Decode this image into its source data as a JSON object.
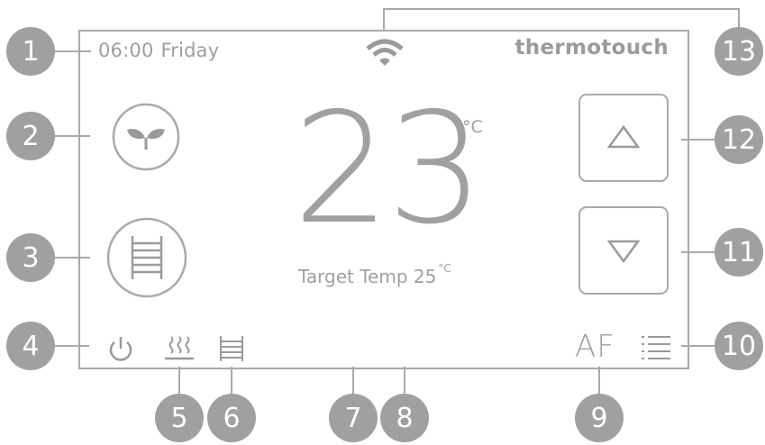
{
  "header": {
    "time": "06:00",
    "day": "Friday",
    "brand": "thermotouch"
  },
  "display": {
    "current_temp": "23",
    "unit": "°C",
    "target_label": "Target Temp 25",
    "target_unit": "°C",
    "mode_label": "AF"
  },
  "icons": {
    "wifi": "wifi-icon",
    "eco": "leaf-icon",
    "towel_rail": "towel-rail-icon",
    "power": "power-icon",
    "floor_heating": "floor-heating-icon",
    "towel_small": "towel-rail-small-icon",
    "menu": "menu-list-icon",
    "up": "up-arrow-icon",
    "down": "down-arrow-icon"
  },
  "callouts": [
    "1",
    "2",
    "3",
    "4",
    "5",
    "6",
    "7",
    "8",
    "9",
    "10",
    "11",
    "12",
    "13"
  ],
  "colors": {
    "outline": "#a9a9a9",
    "text": "#9a9a9a",
    "badge": "#a0a0a0"
  }
}
